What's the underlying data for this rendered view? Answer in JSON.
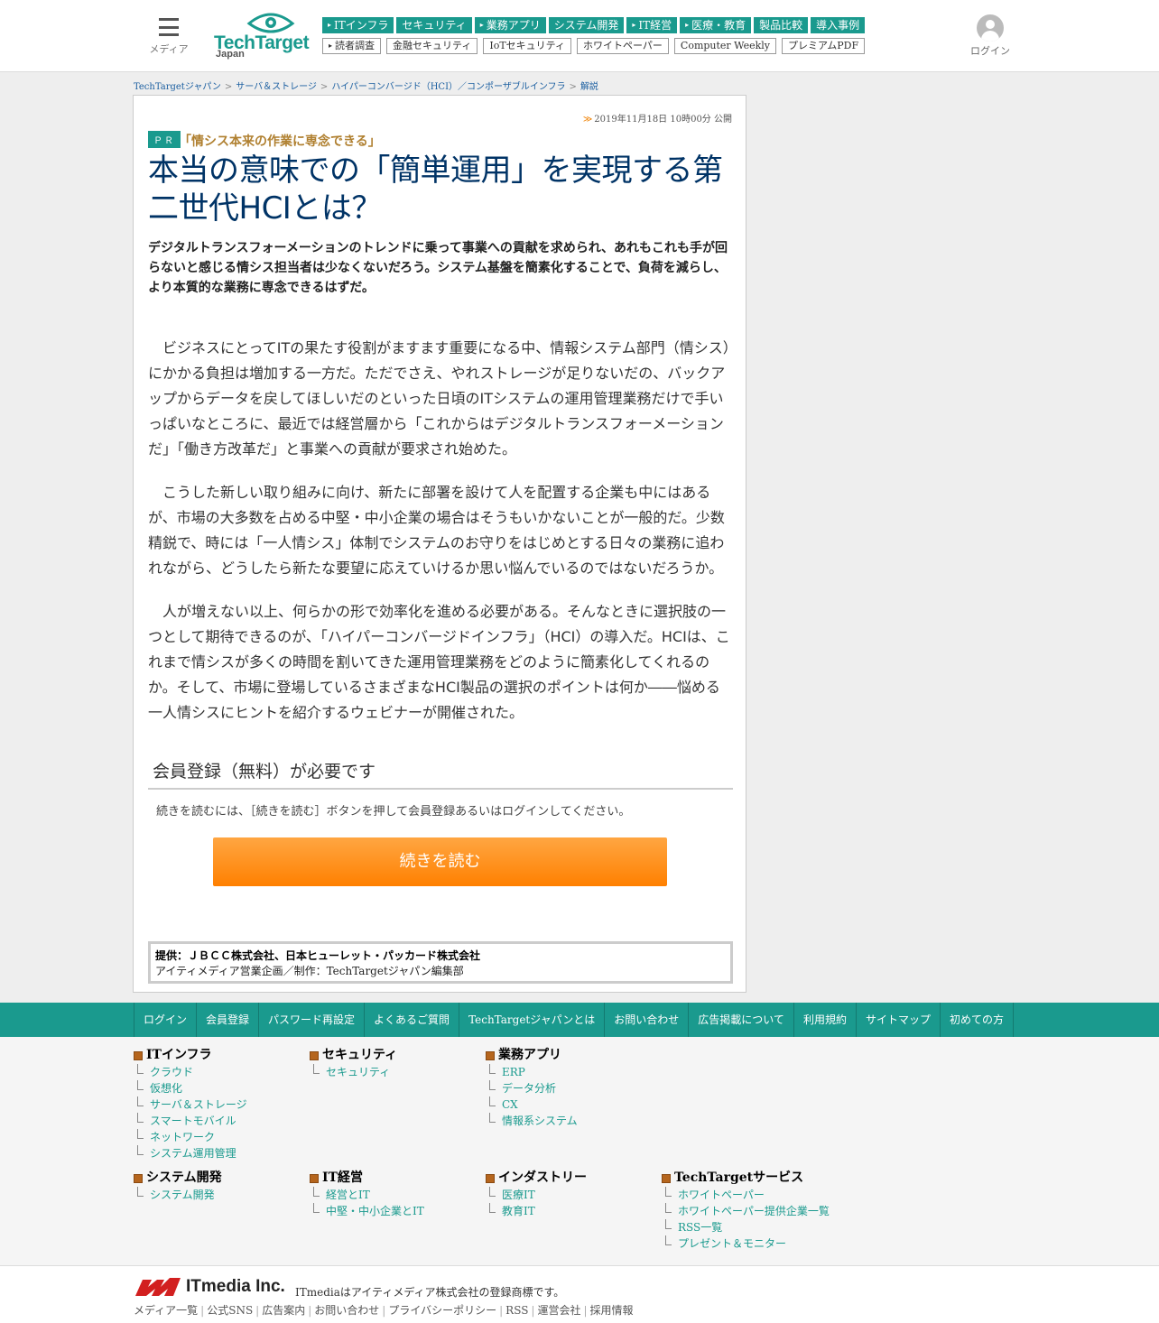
{
  "header": {
    "menu_label": "メディア",
    "logo_text": "TechTarget",
    "logo_sub": "Japan",
    "login_label": "ログイン",
    "nav_primary": [
      {
        "label": "ITインフラ",
        "dot": true
      },
      {
        "label": "セキュリティ",
        "dot": false
      },
      {
        "label": "業務アプリ",
        "dot": true
      },
      {
        "label": "システム開発",
        "dot": false
      },
      {
        "label": "IT経営",
        "dot": true
      },
      {
        "label": "医療・教育",
        "dot": true
      },
      {
        "label": "製品比較",
        "dot": false
      },
      {
        "label": "導入事例",
        "dot": false
      }
    ],
    "nav_secondary": [
      {
        "label": "読者調査",
        "dot": true
      },
      {
        "label": "金融セキュリティ",
        "dot": false
      },
      {
        "label": "IoTセキュリティ",
        "dot": false
      },
      {
        "label": "ホワイトペーパー",
        "dot": false
      },
      {
        "label": "Computer Weekly",
        "dot": false
      },
      {
        "label": "プレミアムPDF",
        "dot": false
      }
    ]
  },
  "breadcrumb": [
    "TechTargetジャパン",
    "サーバ＆ストレージ",
    "ハイパーコンバージド（HCI）／コンポーザブルインフラ",
    "解説"
  ],
  "article": {
    "pub_date": "2019年11月18日 10時00分 公開",
    "pr_label": "ＰＲ",
    "subtitle": "「情シス本来の作業に専念できる」",
    "title": "本当の意味での「簡単運用」を実現する第二世代HCIとは？",
    "lead": "デジタルトランスフォーメーションのトレンドに乗って事業への貢献を求められ、あれもこれも手が回らないと感じる情シス担当者は少なくないだろう。システム基盤を簡素化することで、負荷を減らし、より本質的な業務に専念できるはずだ。",
    "paragraphs": [
      "ビジネスにとってITの果たす役割がますます重要になる中、情報システム部門（情シス）にかかる負担は増加する一方だ。ただでさえ、やれストレージが足りないだの、バックアップからデータを戻してほしいだのといった日頃のITシステムの運用管理業務だけで手いっぱいなところに、最近では経営層から「これからはデジタルトランスフォーメーションだ」「働き方改革だ」と事業への貢献が要求され始めた。",
      "こうした新しい取り組みに向け、新たに部署を設けて人を配置する企業も中にはあるが、市場の大多数を占める中堅・中小企業の場合はそうもいかないことが一般的だ。少数精鋭で、時には「一人情シス」体制でシステムのお守りをはじめとする日々の業務に追われながら、どうしたら新たな要望に応えていけるか思い悩んでいるのではないだろうか。",
      "人が増えない以上、何らかの形で効率化を進める必要がある。そんなときに選択肢の一つとして期待できるのが、「ハイパーコンバージドインフラ」（HCI）の導入だ。HCIは、これまで情シスが多くの時間を割いてきた運用管理業務をどのように簡素化してくれるのか。そして、市場に登場しているさまざまなHCI製品の選択のポイントは何か――悩める一人情シスにヒントを紹介するウェビナーが開催された。"
    ],
    "registration_heading": "会員登録（無料）が必要です",
    "registration_note": "続きを読むには、［続きを読む］ボタンを押して会員登録あるいはログインしてください。",
    "read_more_button": "続きを読む",
    "sponsor_line1": "提供：ＪＢＣＣ株式会社、日本ヒューレット・パッカード株式会社",
    "sponsor_line2": "アイティメディア営業企画／制作：TechTargetジャパン編集部"
  },
  "footer_nav": [
    "ログイン",
    "会員登録",
    "パスワード再設定",
    "よくあるご質問",
    "TechTargetジャパンとは",
    "お問い合わせ",
    "広告掲載について",
    "利用規約",
    "サイトマップ",
    "初めての方"
  ],
  "sitemap": [
    {
      "heading": "ITインフラ",
      "links": [
        "クラウド",
        "仮想化",
        "サーバ＆ストレージ",
        "スマートモバイル",
        "ネットワーク",
        "システム運用管理"
      ]
    },
    {
      "heading": "セキュリティ",
      "links": [
        "セキュリティ"
      ]
    },
    {
      "heading": "業務アプリ",
      "links": [
        "ERP",
        "データ分析",
        "CX",
        "情報系システム"
      ]
    },
    {
      "heading": "システム開発",
      "links": [
        "システム開発"
      ]
    },
    {
      "heading": "IT経営",
      "links": [
        "経営とIT",
        "中堅・中小企業とIT"
      ]
    },
    {
      "heading": "インダストリー",
      "links": [
        "医療IT",
        "教育IT"
      ]
    },
    {
      "heading": "TechTargetサービス",
      "links": [
        "ホワイトペーパー",
        "ホワイトペーパー提供企業一覧",
        "RSS一覧",
        "プレゼント＆モニター"
      ]
    }
  ],
  "bottom": {
    "logo_text": "ITmedia Inc.",
    "trademark": "ITmediaはアイティメディア株式会社の登録商標です。",
    "links": [
      "メディア一覧",
      "公式SNS",
      "広告案内",
      "お問い合わせ",
      "プライバシーポリシー",
      "RSS",
      "運営会社",
      "採用情報"
    ]
  },
  "colors": {
    "brand": "#1a9a8e",
    "title": "#003366",
    "button": "#ff8000",
    "subtitle": "#b08030"
  }
}
